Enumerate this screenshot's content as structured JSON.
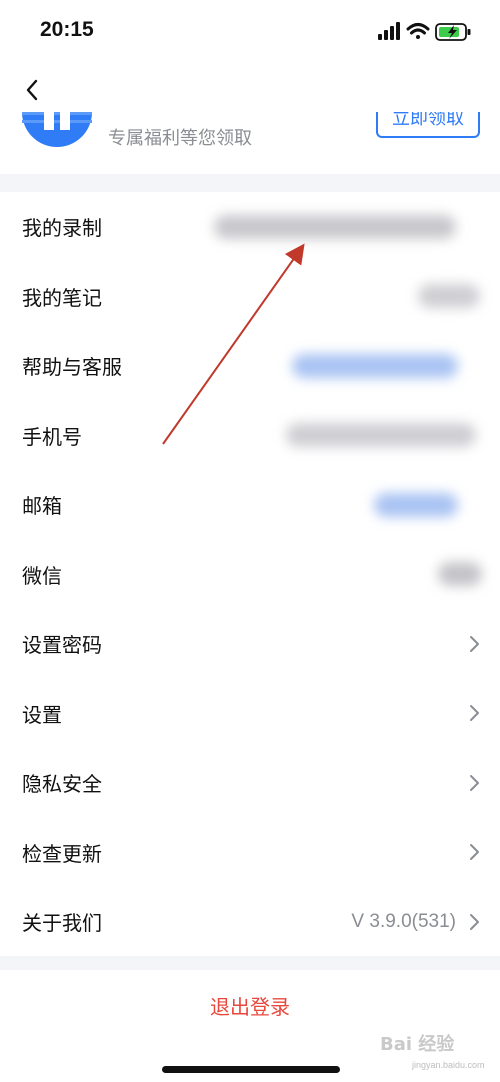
{
  "status_bar": {
    "time": "20:15"
  },
  "promo": {
    "text": "专属福利等您领取",
    "button_label": "立即领取"
  },
  "menu": [
    {
      "label": "我的录制"
    },
    {
      "label": "我的笔记"
    },
    {
      "label": "帮助与客服"
    },
    {
      "label": "手机号"
    },
    {
      "label": "邮箱"
    },
    {
      "label": "微信"
    },
    {
      "label": "设置密码"
    },
    {
      "label": "设置"
    },
    {
      "label": "隐私安全"
    },
    {
      "label": "检查更新"
    },
    {
      "label": "关于我们",
      "value": "V 3.9.0(531)"
    }
  ],
  "logout_label": "退出登录",
  "watermark": {
    "text": "Bai 经验",
    "sub": "jingyan.baidu.com"
  },
  "colors": {
    "accent": "#2f7cf6",
    "danger": "#e8483c",
    "secondary_text": "#8a8d93",
    "band": "#f4f5f8",
    "annotation_arrow": "#c0392b"
  }
}
